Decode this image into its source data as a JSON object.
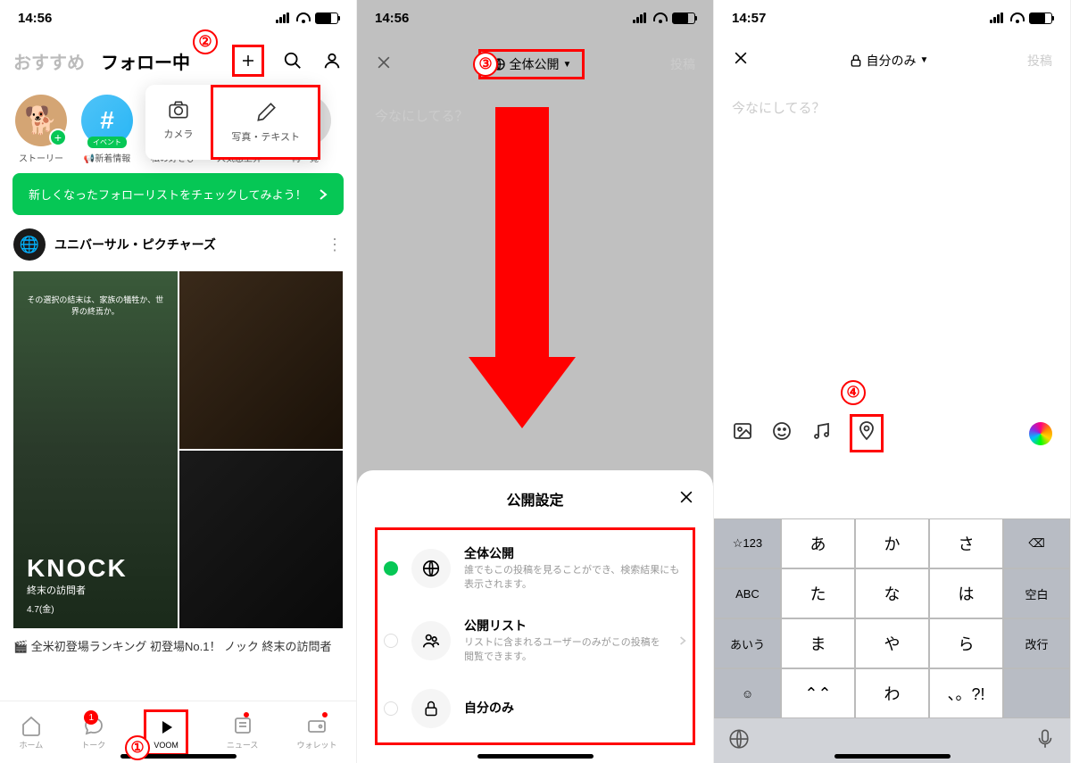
{
  "panel1": {
    "time": "14:56",
    "tabs": {
      "recommended": "おすすめ",
      "following": "フォロー中"
    },
    "menu": {
      "camera": "カメラ",
      "photo_text": "写真・テキスト"
    },
    "stories": [
      {
        "label": "ストーリー"
      },
      {
        "label": "📢新着情報"
      },
      {
        "label": "私の好きび"
      },
      {
        "label": "人気急上昇"
      },
      {
        "label": "再一覧"
      }
    ],
    "banner": "新しくなったフォローリストをチェックしてみよう！",
    "post": {
      "name": "ユニバーサル・ピクチャーズ",
      "movie_title": "KNOCK",
      "movie_sub": "終末の訪問者",
      "tagline": "その選択の結末は、家族の犠牲か、世界の終焉か。",
      "date": "4.7(金)",
      "caption": "🎬 全米初登場ランキング 初登場No.1！ ノック 終末の訪問者"
    },
    "nav": {
      "home": "ホーム",
      "talk": "トーク",
      "voom": "VOOM",
      "news": "ニュース",
      "wallet": "ウォレット",
      "badge": "1"
    }
  },
  "panel2": {
    "time": "14:56",
    "visibility": "全体公開",
    "submit": "投稿",
    "placeholder": "今なにしてる？",
    "sheet": {
      "title": "公開設定",
      "opt1": {
        "title": "全体公開",
        "desc": "誰でもこの投稿を見ることができ、検索結果にも表示されます。"
      },
      "opt2": {
        "title": "公開リスト",
        "desc": "リストに含まれるユーザーのみがこの投稿を閲覧できます。"
      },
      "opt3": {
        "title": "自分のみ"
      }
    }
  },
  "panel3": {
    "time": "14:57",
    "visibility": "自分のみ",
    "submit": "投稿",
    "placeholder": "今なにしてる？",
    "keyboard": {
      "r1": {
        "k0": "☆123",
        "k1": "あ",
        "k2": "か",
        "k3": "さ",
        "k4": "⌫"
      },
      "r2": {
        "k0": "ABC",
        "k1": "た",
        "k2": "な",
        "k3": "は",
        "k4": "空白"
      },
      "r3": {
        "k0": "あいう",
        "k1": "ま",
        "k2": "や",
        "k3": "ら",
        "k4": "改行"
      },
      "r4": {
        "k0": "☺",
        "k1": "⌃⌃",
        "k2": "わ",
        "k3": "、。?!"
      }
    }
  },
  "callouts": {
    "c1": "①",
    "c2": "②",
    "c3": "③",
    "c4": "④"
  }
}
